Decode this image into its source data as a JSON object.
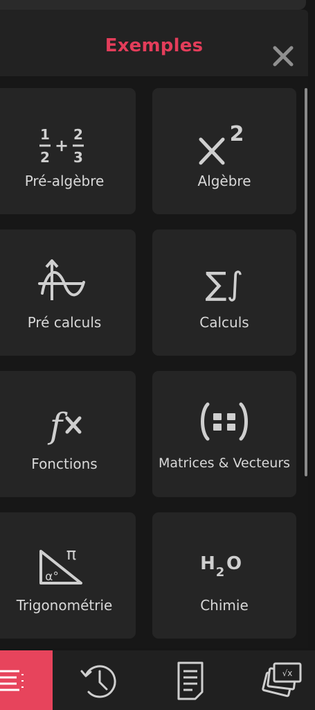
{
  "header": {
    "title": "Exemples",
    "close_icon": "close-icon"
  },
  "categories": [
    {
      "label": "Pré-algèbre",
      "icon": "fraction-sum-icon"
    },
    {
      "label": "Algèbre",
      "icon": "x-squared-icon"
    },
    {
      "label": "Pré calculs",
      "icon": "function-graph-icon"
    },
    {
      "label": "Calculs",
      "icon": "sum-integral-icon"
    },
    {
      "label": "Fonctions",
      "icon": "fx-icon"
    },
    {
      "label": "Matrices & Vecteurs",
      "icon": "matrix-icon"
    },
    {
      "label": "Trigonométrie",
      "icon": "triangle-angle-icon"
    },
    {
      "label": "Chimie",
      "icon": "h2o-icon"
    }
  ],
  "icon_text": {
    "frac_num1": "1",
    "frac_den1": "2",
    "frac_plus": "+",
    "frac_num2": "2",
    "frac_den2": "3",
    "alg_x": "×",
    "alg_exp": "2",
    "calc_sym": "∑∫",
    "fx_f": "f",
    "fx_x": "×",
    "trig_pi": "π",
    "trig_alpha": "α°",
    "chem_h": "H",
    "chem_sub": "2",
    "chem_o": "O",
    "sqrt_card": "√x"
  },
  "bottom_nav": [
    {
      "icon": "menu-list-icon",
      "active": true
    },
    {
      "icon": "history-clock-icon",
      "active": false
    },
    {
      "icon": "notes-document-icon",
      "active": false
    },
    {
      "icon": "flashcards-icon",
      "active": false
    }
  ],
  "colors": {
    "accent": "#e33d5a",
    "active_tab": "#e7445c",
    "card": "#252525",
    "background": "#171717",
    "text": "#d8d8d8"
  }
}
